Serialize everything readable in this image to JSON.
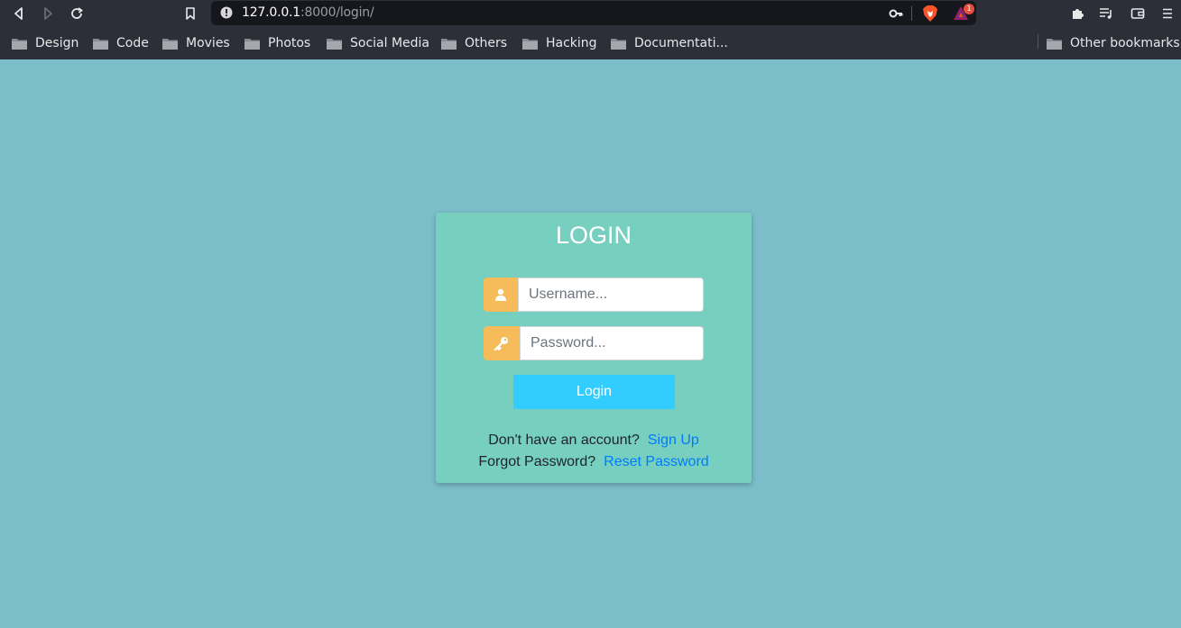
{
  "browser": {
    "url_host": "127.0.0.1",
    "url_rest": ":8000/login/",
    "bat_badge_count": "1",
    "bookmarks": [
      {
        "label": "Design"
      },
      {
        "label": "Code"
      },
      {
        "label": "Movies"
      },
      {
        "label": "Photos"
      },
      {
        "label": "Social Media"
      },
      {
        "label": "Others"
      },
      {
        "label": "Hacking"
      },
      {
        "label": "Documentati..."
      }
    ],
    "other_bookmarks": "Other bookmarks"
  },
  "colors": {
    "page_bg": "#7bbeca",
    "card_bg": "#77cfbf",
    "addon_bg": "#f6bc5a",
    "button_bg": "#33ccff",
    "link": "#007bff"
  },
  "login": {
    "title": "LOGIN",
    "username_icon": "user-icon",
    "username_placeholder": "Username...",
    "password_icon": "key-icon",
    "password_placeholder": "Password...",
    "button_label": "Login",
    "signup_prompt": "Don't have an account?",
    "signup_link": "Sign Up",
    "forgot_prompt": "Forgot Password?",
    "reset_link": "Reset Password"
  }
}
